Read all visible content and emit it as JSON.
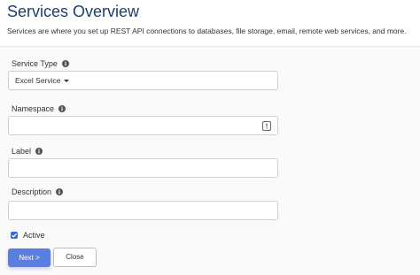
{
  "header": {
    "title": "Services Overview",
    "description": "Services are where you set up REST API connections to databases, file storage, email, remote web services, and more."
  },
  "form": {
    "service_type": {
      "label": "Service Type",
      "value": "Excel Service"
    },
    "namespace": {
      "label": "Namespace",
      "value": ""
    },
    "label_field": {
      "label": "Label",
      "value": ""
    },
    "description": {
      "label": "Description",
      "value": ""
    },
    "active": {
      "label": "Active",
      "checked": true
    }
  },
  "buttons": {
    "next": "Next >",
    "close": "Close"
  },
  "colors": {
    "title": "#1a3f6d",
    "accent": "#5a7fe0",
    "checkbox": "#2f6fd8"
  },
  "icons": {
    "info": "info-circle-icon",
    "namespace_field": "list-icon",
    "dropdown": "caret-down-icon"
  }
}
